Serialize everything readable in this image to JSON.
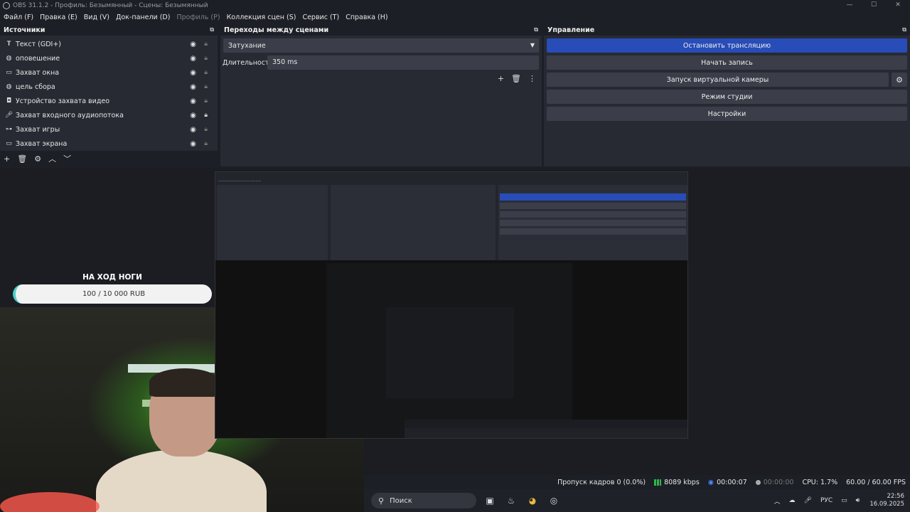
{
  "window": {
    "title": "OBS 31.1.2 - Профиль: Безымянный - Сцены: Безымянный",
    "controls": [
      "—",
      "☐",
      "✕"
    ]
  },
  "menu": [
    {
      "label": "Файл (F)",
      "disabled": false
    },
    {
      "label": "Правка (E)",
      "disabled": false
    },
    {
      "label": "Вид (V)",
      "disabled": false
    },
    {
      "label": "Док-панели (D)",
      "disabled": false
    },
    {
      "label": "Профиль (P)",
      "disabled": true
    },
    {
      "label": "Коллекция сцен (S)",
      "disabled": false
    },
    {
      "label": "Сервис (T)",
      "disabled": false
    },
    {
      "label": "Справка (H)",
      "disabled": false
    }
  ],
  "sources": {
    "title": "Источники",
    "items": [
      {
        "label": "Текст (GDI+)",
        "icon": "text-icon",
        "locked": false
      },
      {
        "label": "оповешение",
        "icon": "globe-icon",
        "locked": false
      },
      {
        "label": "Захват окна",
        "icon": "window-icon",
        "locked": false
      },
      {
        "label": "цель сбора",
        "icon": "globe-icon",
        "locked": false
      },
      {
        "label": "Устройство захвата видео",
        "icon": "camera-icon",
        "locked": false
      },
      {
        "label": "Захват входного аудиопотока",
        "icon": "microphone-icon",
        "locked": true
      },
      {
        "label": "Захват игры",
        "icon": "gamepad-icon",
        "locked": false
      },
      {
        "label": "Захват экрана",
        "icon": "monitor-icon",
        "locked": false
      }
    ]
  },
  "transitions": {
    "title": "Переходы между сценами",
    "selected": "Затухание",
    "duration_label": "Длительность",
    "duration_value": "350 ms"
  },
  "controls": {
    "title": "Управление",
    "stop_stream": "Остановить трансляцию",
    "start_record": "Начать запись",
    "virtual_cam": "Запуск виртуальной камеры",
    "studio_mode": "Режим студии",
    "settings": "Настройки"
  },
  "overlay": {
    "goal_title": "НА ХОД НОГИ",
    "goal_progress": "100 / 10 000 RUB"
  },
  "status": {
    "dropped_frames": "Пропуск кадров 0 (0.0%)",
    "bitrate": "8089 kbps",
    "stream_time": "00:00:07",
    "record_time": "00:00:00",
    "cpu": "CPU: 1.7%",
    "fps": "60.00 / 60.00 FPS"
  },
  "taskbar": {
    "search_placeholder": "Поиск",
    "language": "РУС",
    "time": "22:56",
    "date": "16.09.2025"
  },
  "colors": {
    "primary_button": "#284cb8",
    "bitrate_bar": "#2fb54a"
  }
}
